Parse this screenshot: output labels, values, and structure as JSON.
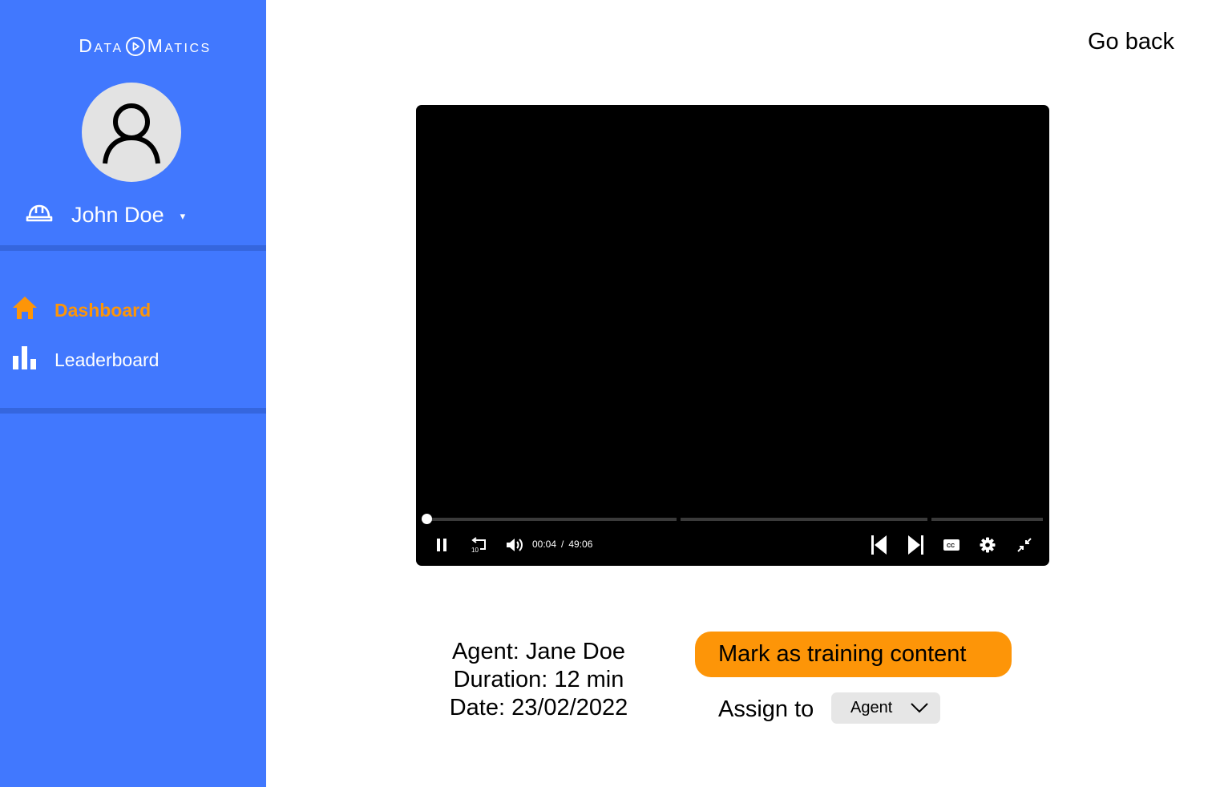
{
  "brand": {
    "logo_left": "Data",
    "logo_right": "Matics",
    "logo_icon": "play-circle-icon"
  },
  "user": {
    "avatar_icon": "user-icon",
    "role_icon": "hard-hat-icon",
    "name": "John Doe",
    "caret": "▾"
  },
  "nav": {
    "items": [
      {
        "label": "Dashboard",
        "icon": "home-icon",
        "active": true
      },
      {
        "label": "Leaderboard",
        "icon": "bar-chart-icon",
        "active": false
      }
    ]
  },
  "header": {
    "go_back": "Go back"
  },
  "player": {
    "current_time": "00:04",
    "separator": "/",
    "total_time": "49:06",
    "progress_fraction": 0.0014
  },
  "info": {
    "agent": "Agent: Jane Doe",
    "duration": "Duration: 12 min",
    "date": "Date: 23/02/2022"
  },
  "actions": {
    "mark_training": "Mark as training content",
    "assign_label": "Assign to",
    "assign_value": "Agent"
  },
  "colors": {
    "sidebar": "#4178fe",
    "accent": "#fd9508",
    "player_bg": "#000000"
  }
}
